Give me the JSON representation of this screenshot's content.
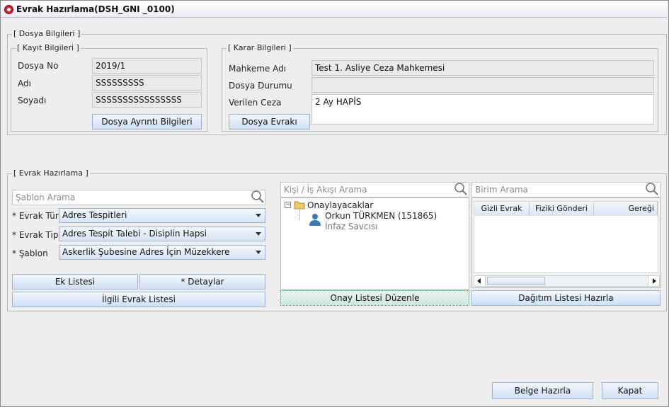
{
  "window": {
    "title": "Evrak Hazırlama(DSH_GNI _0100)"
  },
  "dosya_bilgileri": {
    "legend": "[ Dosya Bilgileri ]",
    "kayit": {
      "legend": "[ Kayıt Bilgileri ]",
      "dosya_no_label": "Dosya No",
      "dosya_no_value": "2019/1",
      "adi_label": "Adı",
      "adi_value": "SSSSSSSSS",
      "soyadi_label": "Soyadı",
      "soyadi_value": "SSSSSSSSSSSSSSSS",
      "button": "Dosya Ayrıntı Bilgileri"
    },
    "karar": {
      "legend": "[ Karar Bilgileri ]",
      "mahkeme_label": "Mahkeme Adı",
      "mahkeme_value": "Test 1. Asliye Ceza Mahkemesi",
      "durum_label": "Dosya Durumu",
      "durum_value": "",
      "ceza_label": "Verilen Ceza",
      "ceza_value": "2 Ay HAPİS",
      "button": "Dosya Evrakı"
    }
  },
  "evrak_hazirlama": {
    "legend": "[ Evrak Hazırlama ]",
    "sablon_search_placeholder": "Şablon Arama",
    "evrak_turu_label": "* Evrak Türü",
    "evrak_turu_value": "Adres Tespitleri",
    "evrak_tipi_label": "* Evrak Tipi",
    "evrak_tipi_value": "Adres Tespit Talebi - Disiplin Hapsi",
    "sablon_label": "* Şablon",
    "sablon_value": "Askerlik Şubesine Adres İçin Müzekkere",
    "ek_listesi_button": "Ek Listesi",
    "detaylar_button": "* Detaylar",
    "ilgili_evrak_button": "İlgili Evrak Listesi",
    "kisi_search_placeholder": "Kişi / İş Akışı Arama",
    "tree": {
      "root_label": "Onaylayacaklar",
      "child_name": "Orkun TÜRKMEN (151865)",
      "child_role": "İnfaz Savcısı"
    },
    "onay_button": "Onay Listesi Düzenle",
    "birim_search_placeholder": "Birim Arama",
    "table_headers": [
      "Gizli Evrak",
      "Fiziki Gönderi",
      "Gereği"
    ],
    "dagitim_button": "Dağıtım Listesi Hazırla"
  },
  "footer": {
    "belge_button": "Belge Hazırla",
    "kapat_button": "Kapat"
  }
}
